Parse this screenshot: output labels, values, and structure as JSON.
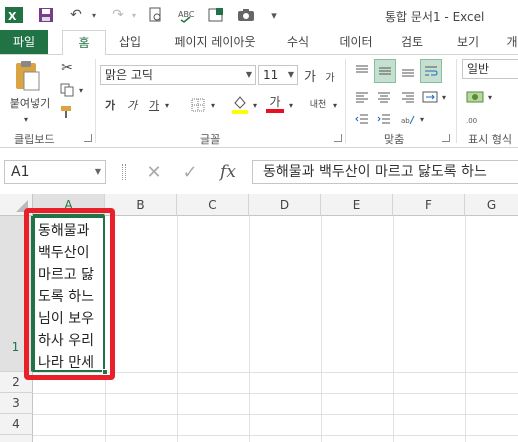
{
  "titlebar": {
    "title": "통합 문서1 - Excel"
  },
  "tabs": [
    "파일",
    "홈",
    "삽입",
    "페이지 레이아웃",
    "수식",
    "데이터",
    "검토",
    "보기",
    "개"
  ],
  "ribbon": {
    "paste_label": "붙여넣기",
    "font_name": "맑은 고딕",
    "font_size": "11",
    "grow_font": "가",
    "shrink_font": "가",
    "bold": "가",
    "italic": "가",
    "underline": "가",
    "font_color_glyph": "가",
    "phonetic": "내천",
    "number_format": "일반",
    "groups": {
      "clipboard": "클립보드",
      "font": "글꼴",
      "alignment": "맞춤",
      "number": "표시 형식"
    },
    "colors": {
      "highlight_yellow": "#ffff00",
      "font_red": "#e81123",
      "accent_green": "#217346"
    }
  },
  "formula_bar": {
    "name_box": "A1",
    "cancel_glyph": "✕",
    "enter_glyph": "✓",
    "fx_label": "fx",
    "content": "동해물과 백두산이 마르고 닳도록 하느"
  },
  "grid": {
    "columns": [
      "A",
      "B",
      "C",
      "D",
      "E",
      "F",
      "G"
    ],
    "rows": [
      "1",
      "2",
      "3",
      "4"
    ],
    "selected_cell": "A1",
    "a1_lines": [
      "동해물과",
      "백두산이",
      "마르고 닳",
      "도록 하느",
      "님이 보우",
      "하사 우리",
      "나라 만세"
    ]
  }
}
